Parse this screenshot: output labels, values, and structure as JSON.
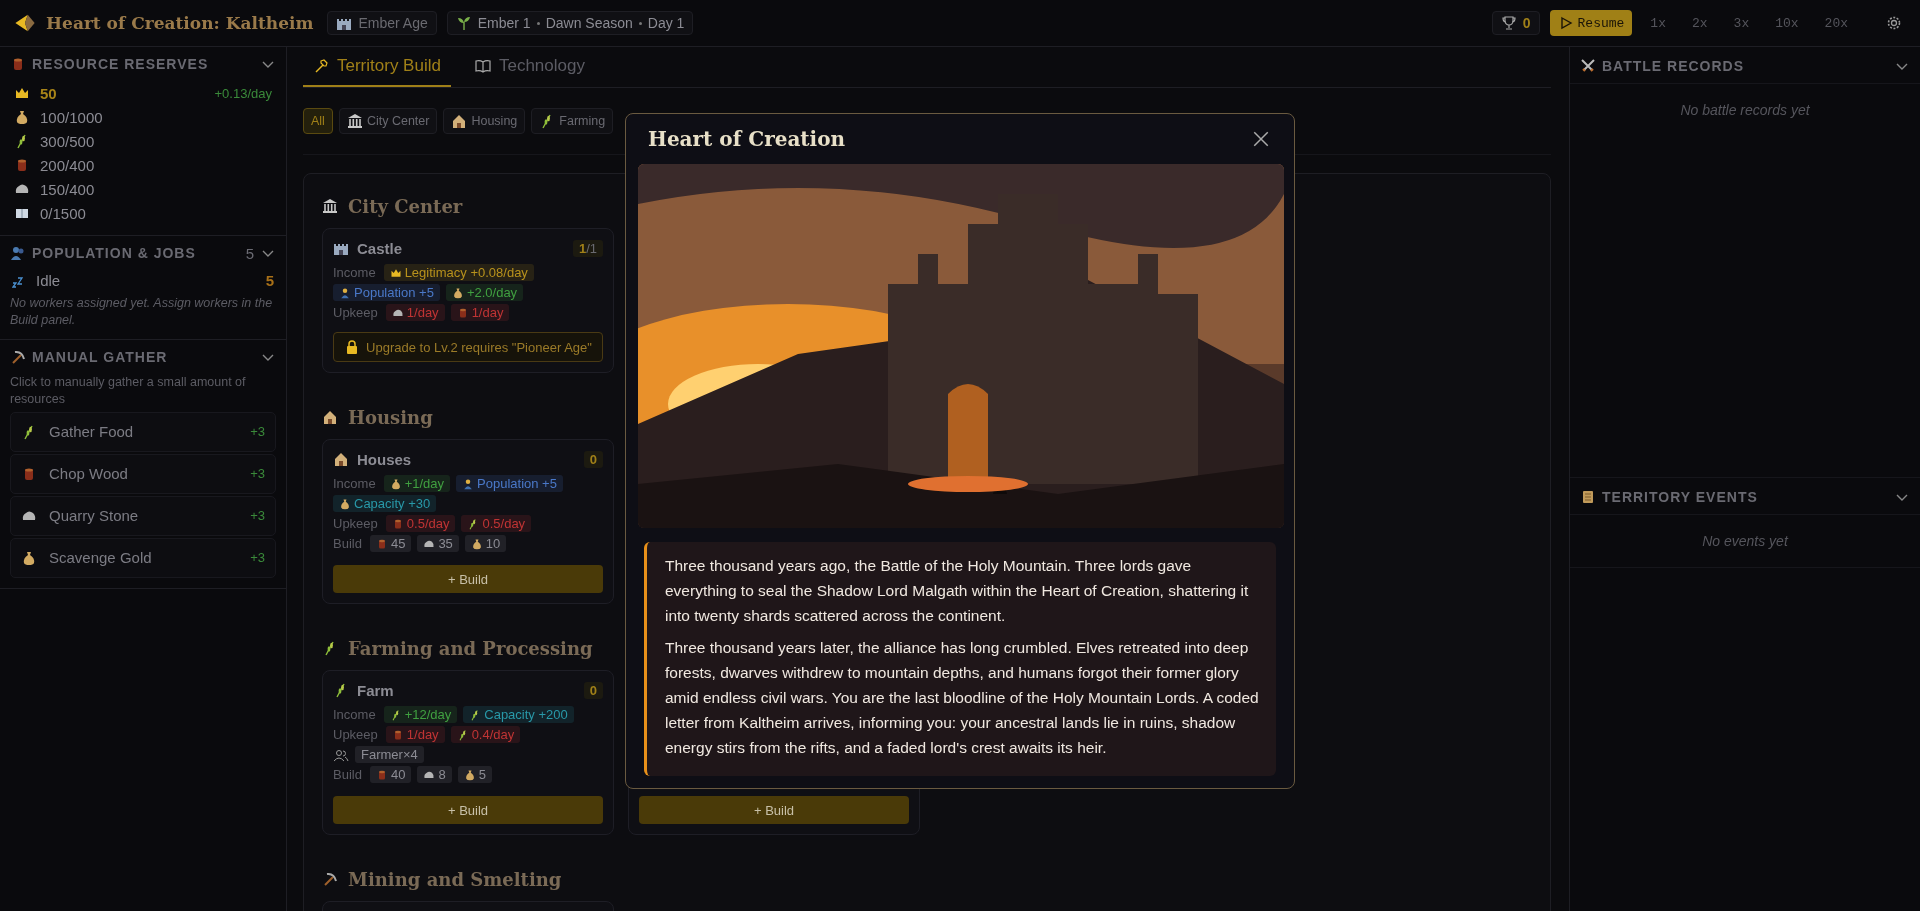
{
  "header": {
    "title": "Heart of Creation: Kaltheim",
    "age": "Ember Age",
    "calendar": [
      "Ember 1",
      "Dawn Season",
      "Day 1"
    ],
    "trophies": "0",
    "resume": "Resume",
    "speeds": [
      {
        "label": "1x",
        "selected": false
      },
      {
        "label": "2x",
        "selected": false
      },
      {
        "label": "3x",
        "selected": false
      },
      {
        "label": "10x",
        "selected": false
      },
      {
        "label": "20x",
        "selected": false
      }
    ]
  },
  "left": {
    "resources": {
      "title": "RESOURCE RESERVES",
      "items": [
        {
          "kind": "crown",
          "value": "50",
          "rate": "+0.13/day",
          "highlight": true
        },
        {
          "kind": "gold",
          "value": "100/1000",
          "highlight": false
        },
        {
          "kind": "food",
          "value": "300/500",
          "highlight": false
        },
        {
          "kind": "wood",
          "value": "200/400",
          "highlight": false
        },
        {
          "kind": "stone",
          "value": "150/400",
          "highlight": false
        },
        {
          "kind": "knowledge",
          "value": "0/1500",
          "highlight": false
        }
      ]
    },
    "population": {
      "title": "POPULATION & JOBS",
      "count": "5",
      "jobs": [
        {
          "label": "Idle",
          "count": "5"
        }
      ],
      "note": "No workers assigned yet. Assign workers in the Build panel."
    },
    "gather": {
      "title": "MANUAL GATHER",
      "hint": "Click to manually gather a small amount of resources",
      "actions": [
        {
          "kind": "food",
          "label": "Gather Food",
          "gain": "+3"
        },
        {
          "kind": "wood",
          "label": "Chop Wood",
          "gain": "+3"
        },
        {
          "kind": "stone",
          "label": "Quarry Stone",
          "gain": "+3"
        },
        {
          "kind": "gold",
          "label": "Scavenge Gold",
          "gain": "+3"
        }
      ]
    }
  },
  "center": {
    "tabs": [
      {
        "kind": "hammer",
        "label": "Territory Build",
        "selected": true
      },
      {
        "kind": "book",
        "label": "Technology",
        "selected": false
      }
    ],
    "filters": [
      {
        "kind": "all",
        "label": "All",
        "selected": true
      },
      {
        "kind": "temple",
        "label": "City Center",
        "selected": false
      },
      {
        "kind": "house",
        "label": "Housing",
        "selected": false
      },
      {
        "kind": "food",
        "label": "Farming",
        "selected": false
      }
    ],
    "sections": [
      {
        "kind": "temple",
        "title": "City Center",
        "cards": [
          {
            "kind": "castle",
            "name": "Castle",
            "count": "1",
            "limit": "/1",
            "rows": [
              {
                "kind": "stats",
                "label": "Income",
                "chips": [
                  {
                    "kind": "crown",
                    "text": "Legitimacy +0.08/day",
                    "color": "#b8921c"
                  },
                  {
                    "kind": "person",
                    "text": "Population +5",
                    "color": "#4a78c8"
                  },
                  {
                    "kind": "gold",
                    "text": "+2.0/day",
                    "color": "#40a040"
                  }
                ]
              },
              {
                "kind": "stats",
                "label": "Upkeep",
                "chips": [
                  {
                    "kind": "stone",
                    "text": "1/day",
                    "color": "#c03434"
                  },
                  {
                    "kind": "wood",
                    "text": "1/day",
                    "color": "#c03434"
                  }
                ]
              }
            ],
            "notice": "Upgrade to Lv.2 requires \"Pioneer Age\""
          }
        ]
      },
      {
        "kind": "house",
        "title": "Housing",
        "cards": [
          {
            "kind": "house",
            "name": "Houses",
            "count": "0",
            "rows": [
              {
                "kind": "stats",
                "label": "Income",
                "chips": [
                  {
                    "kind": "gold",
                    "text": "+1/day",
                    "color": "#40a040"
                  },
                  {
                    "kind": "person",
                    "text": "Population +5",
                    "color": "#4a78c8"
                  },
                  {
                    "kind": "gold",
                    "text": "Capacity +30",
                    "color": "#2898a8"
                  }
                ]
              },
              {
                "kind": "stats",
                "label": "Upkeep",
                "chips": [
                  {
                    "kind": "wood",
                    "text": "0.5/day",
                    "color": "#c03434"
                  },
                  {
                    "kind": "food",
                    "text": "0.5/day",
                    "color": "#c03434"
                  }
                ]
              },
              {
                "kind": "stats",
                "label": "Build",
                "chips": [
                  {
                    "kind": "wood",
                    "text": "45",
                    "color": "#8c8c94"
                  },
                  {
                    "kind": "stone",
                    "text": "35",
                    "color": "#8c8c94"
                  },
                  {
                    "kind": "gold",
                    "text": "10",
                    "color": "#8c8c94"
                  }
                ]
              }
            ],
            "button": "+ Build"
          }
        ]
      },
      {
        "kind": "food",
        "title": "Farming and Processing",
        "cards": [
          {
            "kind": "food",
            "name": "Farm",
            "count": "0",
            "rows": [
              {
                "kind": "stats",
                "label": "Income",
                "chips": [
                  {
                    "kind": "food",
                    "text": "+12/day",
                    "color": "#40a040"
                  },
                  {
                    "kind": "food",
                    "text": "Capacity +200",
                    "color": "#2898a8"
                  }
                ]
              },
              {
                "kind": "stats",
                "label": "Upkeep",
                "chips": [
                  {
                    "kind": "wood",
                    "text": "1/day",
                    "color": "#c03434"
                  },
                  {
                    "kind": "food",
                    "text": "0.4/day",
                    "color": "#c03434"
                  }
                ]
              },
              {
                "kind": "workers",
                "chips": [
                  {
                    "kind": "none",
                    "text": "Farmer×4",
                    "color": "#8c8c94"
                  }
                ]
              },
              {
                "kind": "stats",
                "label": "Build",
                "chips": [
                  {
                    "kind": "wood",
                    "text": "40",
                    "color": "#8c8c94"
                  },
                  {
                    "kind": "stone",
                    "text": "8",
                    "color": "#8c8c94"
                  },
                  {
                    "kind": "gold",
                    "text": "5",
                    "color": "#8c8c94"
                  }
                ]
              }
            ],
            "button": "+ Build"
          },
          {
            "kind": "hidden",
            "button": "+ Build"
          }
        ]
      },
      {
        "kind": "pickaxe",
        "title": "Mining and Smelting",
        "cards": [
          {
            "kind": "hidden"
          }
        ]
      }
    ]
  },
  "right": {
    "battles": {
      "title": "BATTLE RECORDS",
      "empty": "No battle records yet"
    },
    "events": {
      "title": "TERRITORY EVENTS",
      "empty": "No events yet"
    }
  },
  "modal": {
    "title": "Heart of Creation",
    "picture": {
      "kind": "picture"
    },
    "paragraphs": [
      "Three thousand years ago, the Battle of the Holy Mountain. Three lords gave everything to seal the Shadow Lord Malgath within the Heart of Creation, shattering it into twenty shards scattered across the continent.",
      "Three thousand years later, the alliance has long crumbled. Elves retreated into deep forests, dwarves withdrew to mountain depths, and humans forgot their former glory amid endless civil wars. You are the last bloodline of the Holy Mountain Lords. A coded letter from Kaltheim arrives, informing you: your ancestral lands lie in ruins, shadow energy stirs from the rifts, and a faded lord's crest awaits its heir."
    ]
  }
}
